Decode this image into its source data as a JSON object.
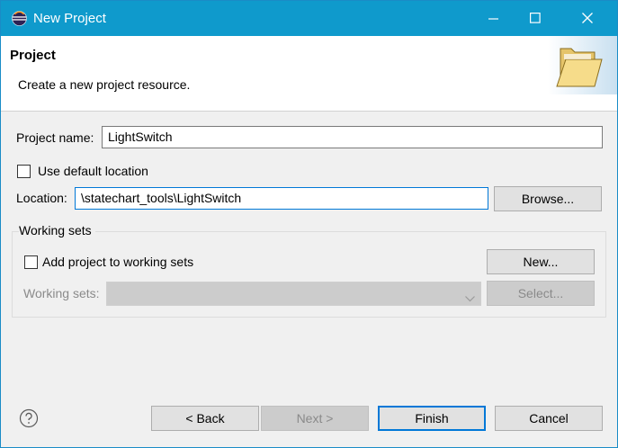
{
  "window": {
    "title": "New Project",
    "accent": "#0f9acc",
    "controls": [
      "minimize-icon",
      "maximize-icon",
      "close-icon"
    ]
  },
  "header": {
    "title": "Project",
    "description": "Create a new project resource.",
    "icon": "folder-icon"
  },
  "form": {
    "project_name_label": "Project name:",
    "project_name_value": "LightSwitch",
    "use_default_location_label": "Use default location",
    "use_default_location_checked": false,
    "location_label": "Location:",
    "location_value": "\\statechart_tools\\LightSwitch",
    "browse_label": "Browse..."
  },
  "working_sets": {
    "group_label": "Working sets",
    "add_label": "Add project to working sets",
    "add_checked": false,
    "new_label": "New...",
    "sets_label": "Working sets:",
    "sets_value": "",
    "select_label": "Select..."
  },
  "footer": {
    "help_icon": "help-icon",
    "back_label": "< Back",
    "next_label": "Next >",
    "finish_label": "Finish",
    "cancel_label": "Cancel"
  }
}
